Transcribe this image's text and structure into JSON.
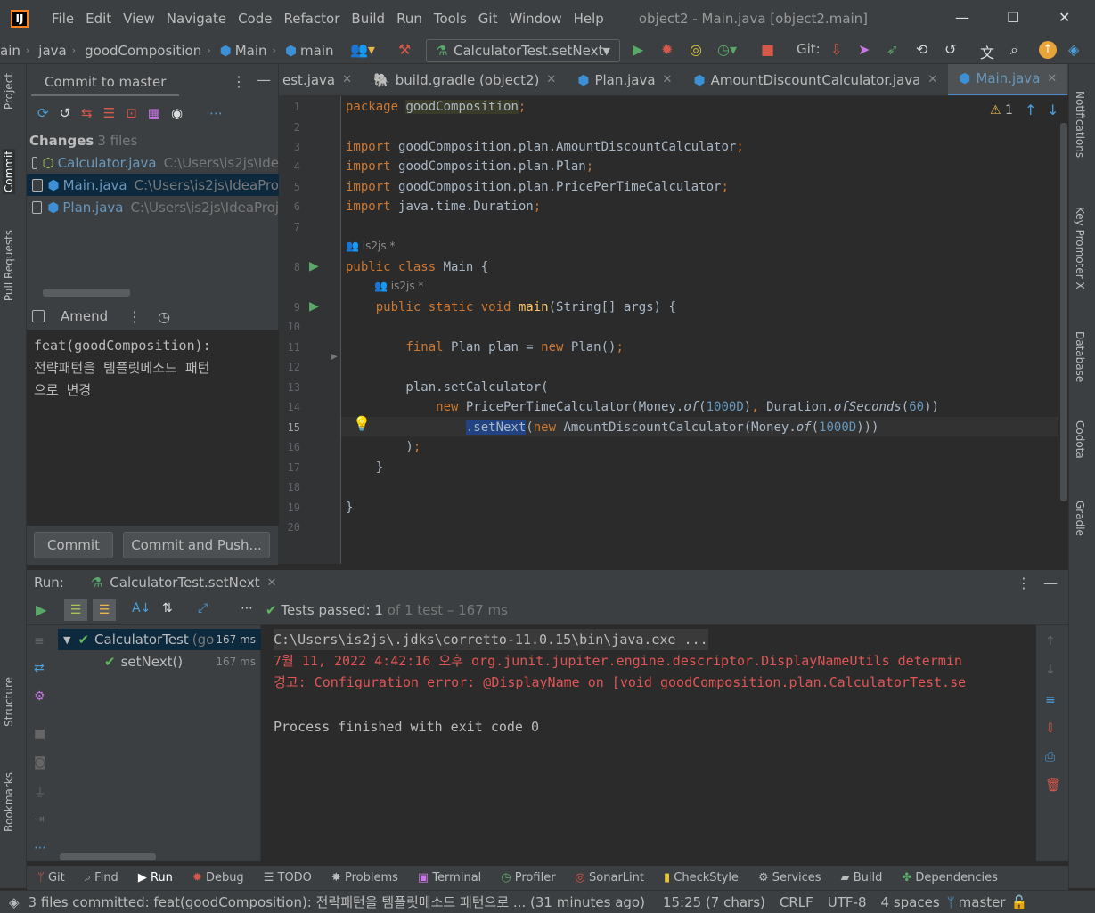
{
  "menubar": {
    "items": [
      "File",
      "Edit",
      "View",
      "Navigate",
      "Code",
      "Refactor",
      "Build",
      "Run",
      "Tools",
      "Git",
      "Window",
      "Help"
    ],
    "window_title": "object2 - Main.java [object2.main]"
  },
  "navbar": {
    "crumbs": [
      "ain",
      "java",
      "goodComposition",
      "Main",
      "main"
    ],
    "run_config": "CalculatorTest.setNext",
    "git_label": "Git:"
  },
  "left_strip": {
    "tabs": [
      "Project",
      "Commit",
      "Pull Requests",
      "Structure",
      "Bookmarks"
    ]
  },
  "right_strip": {
    "tabs": [
      "Notifications",
      "Key Promoter X",
      "Database",
      "Codota",
      "Gradle"
    ]
  },
  "commit_panel": {
    "title": "Commit to master",
    "changes_label": "Changes",
    "changes_count": "3 files",
    "files": [
      {
        "name": "Calculator.java",
        "path": "C:\\Users\\is2js\\Ide"
      },
      {
        "name": "Main.java",
        "path": "C:\\Users\\is2js\\IdeaPro"
      },
      {
        "name": "Plan.java",
        "path": "C:\\Users\\is2js\\IdeaProj"
      }
    ],
    "amend_label": "Amend",
    "message_lines": [
      "feat(goodComposition):",
      "전략패턴을 템플릿메소드 패턴",
      "으로 변경"
    ],
    "commit_button": "Commit",
    "commit_push_button": "Commit and Push..."
  },
  "editor_tabs": [
    {
      "label": "est.java",
      "active": false
    },
    {
      "label": "build.gradle (object2)",
      "active": false
    },
    {
      "label": "Plan.java",
      "active": false
    },
    {
      "label": "AmountDiscountCalculator.java",
      "active": false
    },
    {
      "label": "Main.java",
      "active": true
    }
  ],
  "editor": {
    "warning_count": "1",
    "author_hint": "is2js *",
    "line_numbers": [
      "1",
      "2",
      "3",
      "4",
      "5",
      "6",
      "7",
      "8",
      "9",
      "10",
      "11",
      "12",
      "13",
      "14",
      "15",
      "16",
      "17",
      "18",
      "19",
      "20"
    ]
  },
  "run_panel": {
    "label": "Run:",
    "tab": "CalculatorTest.setNext",
    "tests_passed": "Tests passed:",
    "tests_count": "1",
    "tests_detail": "of 1 test – 167 ms",
    "tree": [
      {
        "name": "CalculatorTest",
        "extra": "(go",
        "time": "167 ms"
      },
      {
        "name": "setNext()",
        "extra": "",
        "time": "167 ms"
      }
    ],
    "console": [
      "C:\\Users\\is2js\\.jdks\\corretto-11.0.15\\bin\\java.exe ...",
      "7월 11, 2022 4:42:16 오후 org.junit.jupiter.engine.descriptor.DisplayNameUtils determin",
      "경고: Configuration error: @DisplayName on [void goodComposition.plan.CalculatorTest.se",
      "",
      "Process finished with exit code 0"
    ]
  },
  "bottom_tabs": [
    "Git",
    "Find",
    "Run",
    "Debug",
    "TODO",
    "Problems",
    "Terminal",
    "Profiler",
    "SonarLint",
    "CheckStyle",
    "Services",
    "Build",
    "Dependencies"
  ],
  "statusbar": {
    "message": "3 files committed: feat(goodComposition): 전략패턴을 템플릿메소드 패턴으로 ... (31 minutes ago)",
    "position": "15:25 (7 chars)",
    "line_sep": "CRLF",
    "encoding": "UTF-8",
    "indent": "4 spaces",
    "branch": "master"
  },
  "colors": {
    "accent": "#4a88c7",
    "keyword": "#cc7832",
    "number": "#6897bb",
    "error_text": "#e05555",
    "pass": "#5fb85f"
  }
}
